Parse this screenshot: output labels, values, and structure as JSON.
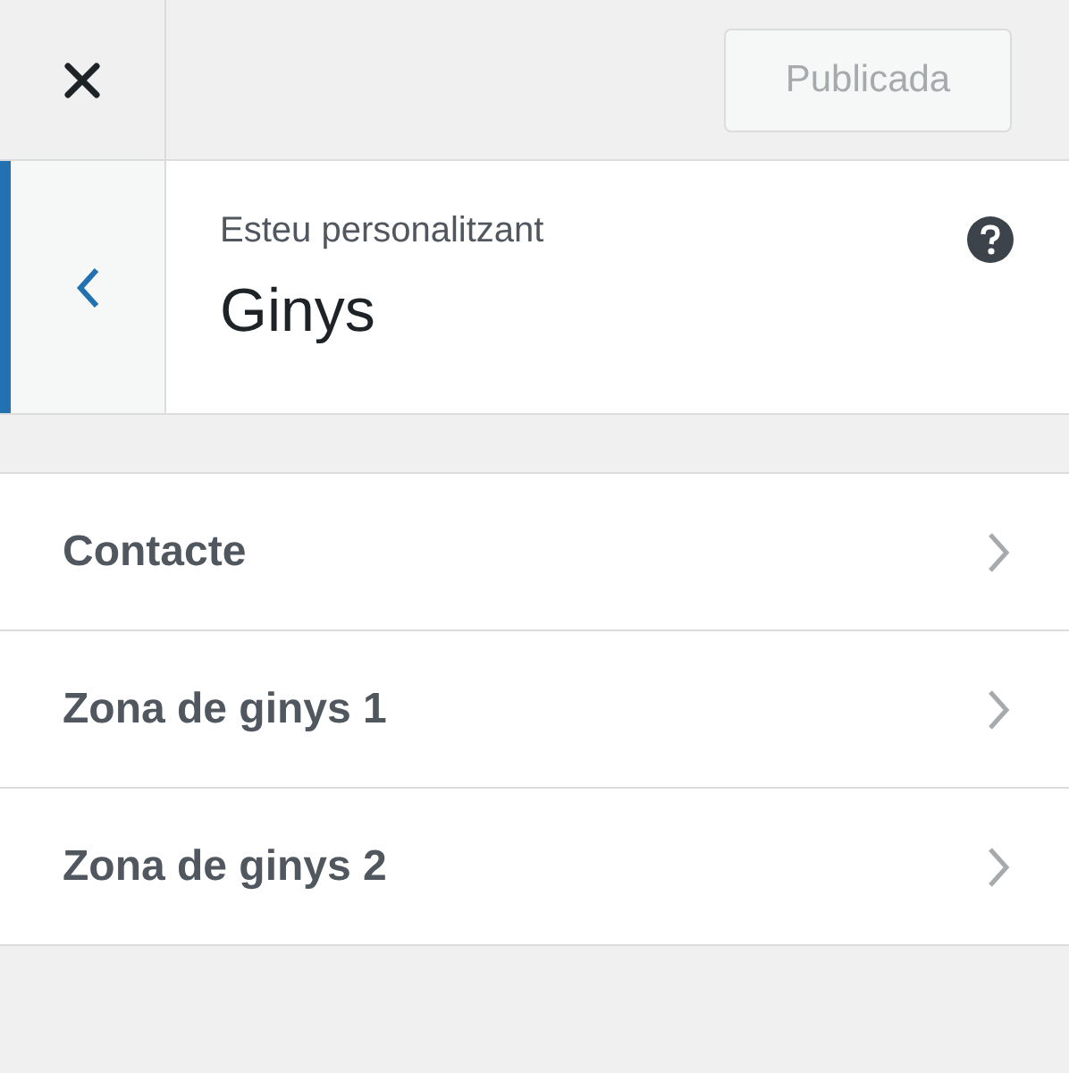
{
  "header_bar": {
    "publish_button": {
      "label": "Publicada",
      "disabled": true
    }
  },
  "panel_header": {
    "subtitle": "Esteu personalitzant",
    "title": "Ginys"
  },
  "sections": [
    {
      "title": "Contacte"
    },
    {
      "title": "Zona de ginys 1"
    },
    {
      "title": "Zona de ginys 2"
    }
  ]
}
